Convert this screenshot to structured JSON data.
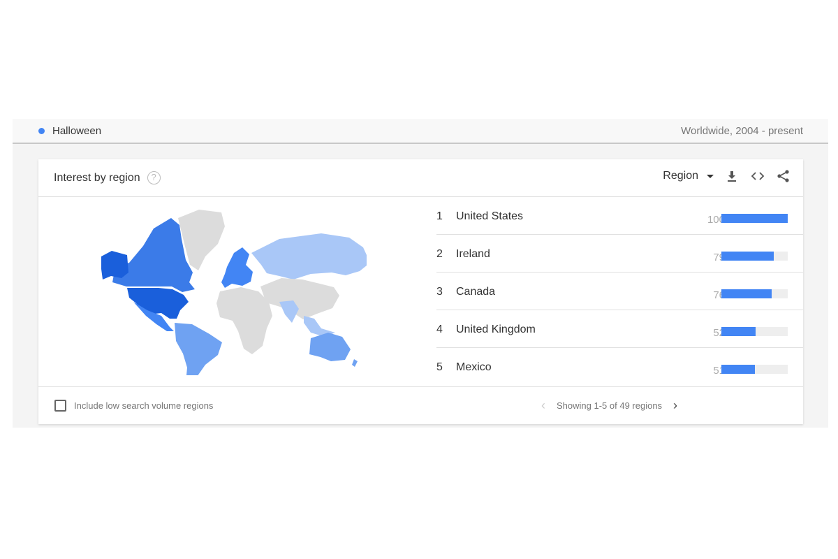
{
  "header": {
    "term": "Halloween",
    "term_color": "#4285f4",
    "scope": "Worldwide, 2004 - present"
  },
  "card": {
    "title": "Interest by region",
    "help_icon": "?",
    "resolution_select": "Region",
    "icons": [
      "download-icon",
      "embed-code-icon",
      "share-icon"
    ],
    "rows": [
      {
        "rank": "1",
        "name": "United States",
        "value": 100
      },
      {
        "rank": "2",
        "name": "Ireland",
        "value": 79
      },
      {
        "rank": "3",
        "name": "Canada",
        "value": 76
      },
      {
        "rank": "4",
        "name": "United Kingdom",
        "value": 52
      },
      {
        "rank": "5",
        "name": "Mexico",
        "value": 51
      }
    ],
    "include_low_volume_label": "Include low search volume regions",
    "include_low_volume_checked": false,
    "pagination": "Showing 1-5 of 49 regions"
  },
  "colors": {
    "accent": "#4285f4",
    "map_high": "#1a5fdb",
    "map_mid": "#4285f4",
    "map_low": "#a9c7f7",
    "map_none": "#dcdcdc"
  }
}
